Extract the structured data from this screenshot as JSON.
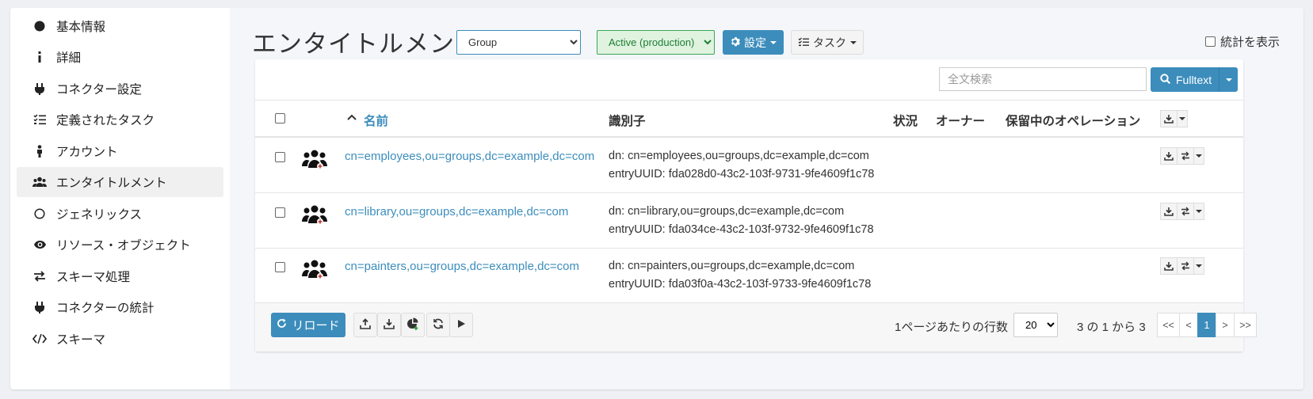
{
  "sidebar": {
    "items": [
      {
        "label": "基本情報",
        "icon": "circle-filled-icon"
      },
      {
        "label": "詳細",
        "icon": "info-icon"
      },
      {
        "label": "コネクター設定",
        "icon": "plug-icon"
      },
      {
        "label": "定義されたタスク",
        "icon": "task-list-icon"
      },
      {
        "label": "アカウント",
        "icon": "person-icon"
      },
      {
        "label": "エンタイトルメント",
        "icon": "users-icon",
        "active": true
      },
      {
        "label": "ジェネリックス",
        "icon": "circle-outline-icon"
      },
      {
        "label": "リソース・オブジェクト",
        "icon": "eye-icon"
      },
      {
        "label": "スキーマ処理",
        "icon": "exchange-icon"
      },
      {
        "label": "コネクターの統計",
        "icon": "plug-icon"
      },
      {
        "label": "スキーマ",
        "icon": "code-icon"
      }
    ]
  },
  "header": {
    "title": "エンタイトルメント",
    "kind_select": "Group",
    "status_select": "Active (production)",
    "settings_label": "設定",
    "tasks_label": "タスク",
    "show_stats_label": "統計を表示"
  },
  "search": {
    "placeholder": "全文検索",
    "button_label": "Fulltext"
  },
  "table": {
    "columns": {
      "name": "名前",
      "identifier": "識別子",
      "status": "状況",
      "owner": "オーナー",
      "pending": "保留中のオペレーション"
    },
    "rows": [
      {
        "name": "cn=employees,ou=groups,dc=example,dc=com",
        "dn": "dn: cn=employees,ou=groups,dc=example,dc=com",
        "uuid": "entryUUID: fda028d0-43c2-103f-9731-9fe4609f1c78"
      },
      {
        "name": "cn=library,ou=groups,dc=example,dc=com",
        "dn": "dn: cn=library,ou=groups,dc=example,dc=com",
        "uuid": "entryUUID: fda034ce-43c2-103f-9732-9fe4609f1c78"
      },
      {
        "name": "cn=painters,ou=groups,dc=example,dc=com",
        "dn": "dn: cn=painters,ou=groups,dc=example,dc=com",
        "uuid": "entryUUID: fda03f0a-43c2-103f-9733-9fe4609f1c78"
      }
    ]
  },
  "footer": {
    "reload_label": "リロード",
    "rows_per_page_label": "1ページあたりの行数",
    "rows_per_page_value": "20",
    "range_label": "3 の 1 から 3",
    "pager": [
      "<<",
      "<",
      "1",
      ">",
      ">>"
    ]
  },
  "colors": {
    "accent": "#3c8dbc",
    "status_green": "#3aa757"
  }
}
